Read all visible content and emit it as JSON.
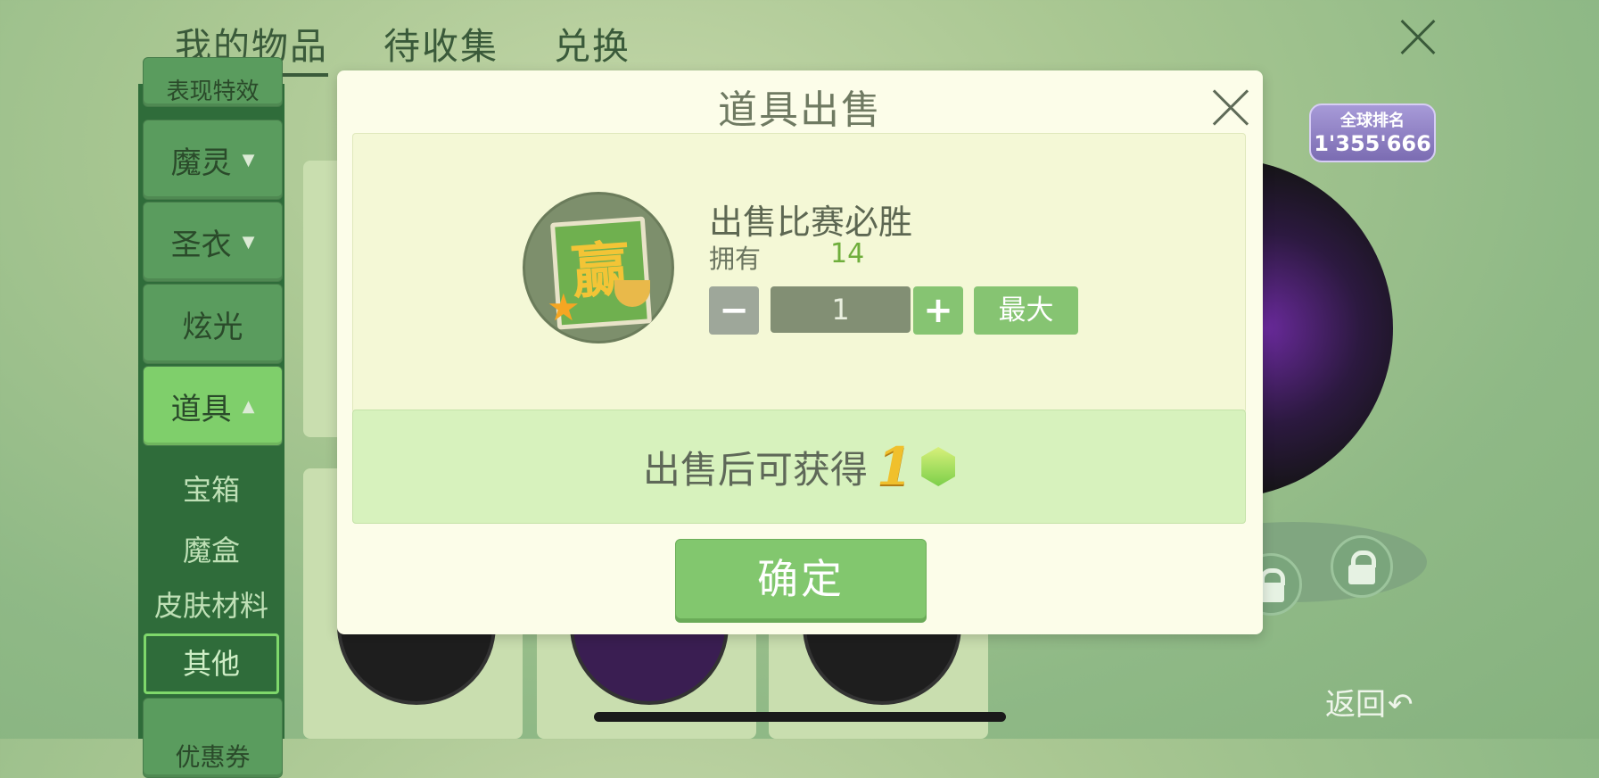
{
  "topnav": {
    "tabs": [
      {
        "label": "我的物品"
      },
      {
        "label": "待收集"
      },
      {
        "label": "兑换"
      }
    ]
  },
  "sidebar": {
    "partial_top": "表现特效",
    "items": [
      {
        "label": "魔灵",
        "arrow": "▼"
      },
      {
        "label": "圣衣",
        "arrow": "▼"
      },
      {
        "label": "炫光"
      },
      {
        "label": "道具",
        "arrow": "▲"
      }
    ],
    "subitems": [
      "宝箱",
      "魔盒",
      "皮肤材料",
      "其他"
    ],
    "partial_bottom": "优惠券"
  },
  "ranking": {
    "title": "全球排名",
    "value": "1'355'666"
  },
  "back": {
    "label": "返回"
  },
  "modal": {
    "title": "道具出售",
    "item_name": "出售比赛必胜",
    "item_glyph": "赢",
    "own_label": "拥有",
    "own_value": "14",
    "minus": "−",
    "plus": "+",
    "quantity": "1",
    "max_label": "最大",
    "reward_text": "出售后可获得",
    "reward_amount": "1",
    "confirm_label": "确定"
  },
  "colors": {
    "accent_green": "#82c76e",
    "sidebar_dark": "#2f6c3a",
    "modal_bg": "#fcfde9",
    "gold": "#f0c02c"
  }
}
